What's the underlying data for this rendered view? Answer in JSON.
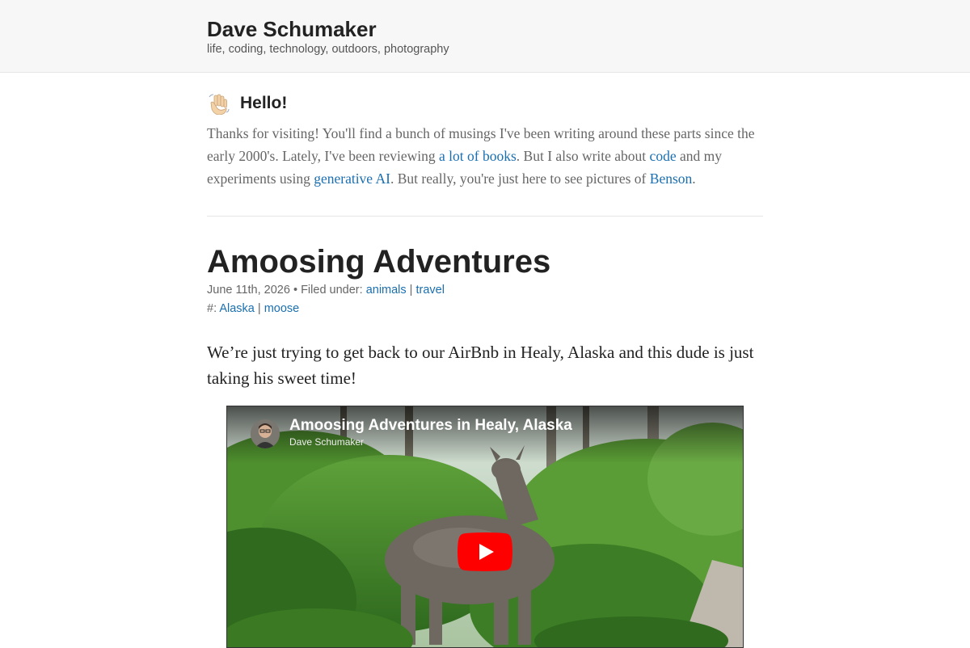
{
  "header": {
    "site_title": "Dave Schumaker",
    "tagline": "life, coding, technology, outdoors, photography"
  },
  "hello": {
    "heading": "Hello!",
    "text_1": "Thanks for visiting! You'll find a bunch of musings I've been writing around these parts since the early 2000's. Lately, I've been reviewing ",
    "link_books": "a lot of books",
    "text_2": ". But I also write about ",
    "link_code": "code",
    "text_3": " and my experiments using ",
    "link_ai": "generative AI",
    "text_4": ". But really, you're just here to see pictures of ",
    "link_benson": "Benson",
    "text_5": "."
  },
  "post": {
    "title": "Amoosing Adventures",
    "date": "June 11th, 2026",
    "bullet": " • ",
    "filed_label": "Filed under: ",
    "categories": [
      "animals",
      "travel"
    ],
    "pipe": " | ",
    "tags_label": "#: ",
    "tags": [
      "Alaska",
      "moose"
    ],
    "lede": "We’re just trying to get back to our AirBnb in Healy, Alaska and this dude is just taking his sweet time!"
  },
  "video": {
    "title": "Amoosing Adventures in Healy, Alaska",
    "channel": "Dave Schumaker",
    "play_icon": "play-icon",
    "play_color": "#ff0000"
  }
}
